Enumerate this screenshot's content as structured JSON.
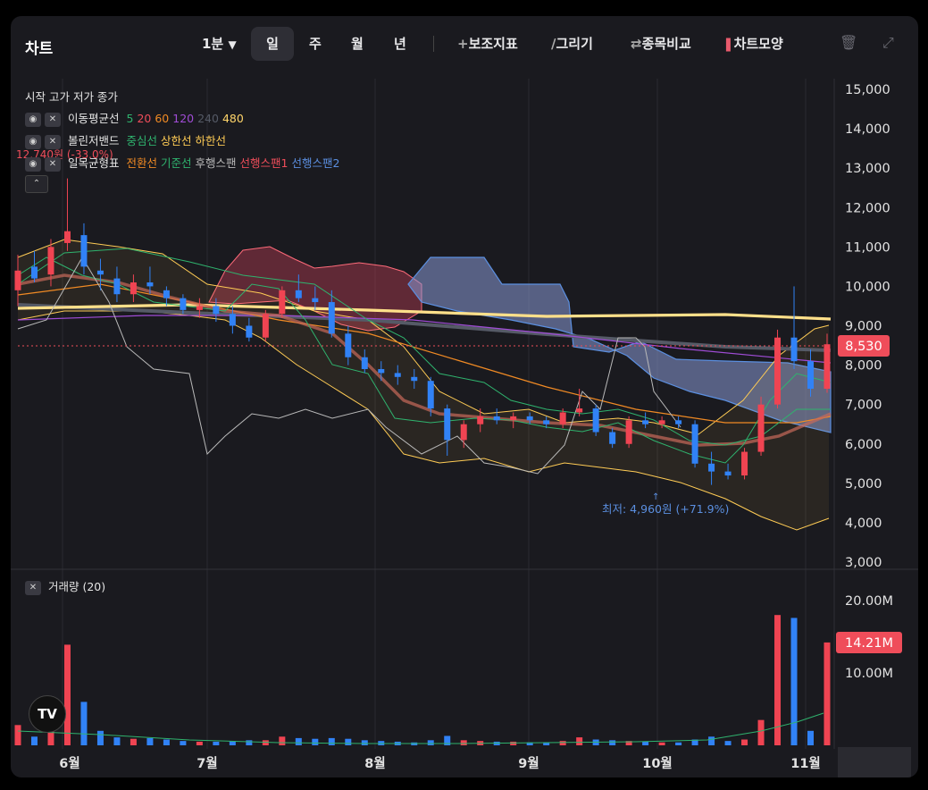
{
  "header": {
    "title": "차트",
    "interval": "1분",
    "periods": [
      "일",
      "주",
      "월",
      "년"
    ],
    "selected_period": "일",
    "tools": [
      "보조지표",
      "그리기",
      "종목비교",
      "차트모양"
    ]
  },
  "legend": {
    "ohlc_label": "시작 고가 저가 종가",
    "ma": {
      "name": "이동평균선",
      "periods": [
        {
          "label": "5",
          "color": "#2fb36e"
        },
        {
          "label": "20",
          "color": "#ef4d5a"
        },
        {
          "label": "60",
          "color": "#f08a24"
        },
        {
          "label": "120",
          "color": "#a04cd6"
        },
        {
          "label": "240",
          "color": "#555a66"
        },
        {
          "label": "480",
          "color": "#ffd56a"
        }
      ]
    },
    "bb": {
      "name": "볼린저밴드",
      "lines": [
        {
          "label": "중심선",
          "color": "#2fb36e"
        },
        {
          "label": "상한선",
          "color": "#ffcc55"
        },
        {
          "label": "하한선",
          "color": "#ffcc55"
        }
      ]
    },
    "ichimoku": {
      "name": "일목균형표",
      "lines": [
        {
          "label": "전환선",
          "color": "#f08a24"
        },
        {
          "label": "기준선",
          "color": "#2fb36e"
        },
        {
          "label": "후행스팬",
          "color": "#b9b9b9"
        },
        {
          "label": "선행스팬1",
          "color": "#ef4d5a"
        },
        {
          "label": "선행스팬2",
          "color": "#5b8fe0"
        }
      ]
    },
    "high_marker": "12,740원 (-33.0%)",
    "volume_label": "거래량 (20)"
  },
  "annotations": {
    "low_marker": "최저: 4,960원 (+71.9%)"
  },
  "price_tag": "8,530",
  "volume_tag": "14.21M",
  "chart_data": {
    "type": "candlestick",
    "y_axis": {
      "ticks": [
        "15,000",
        "14,000",
        "13,000",
        "12,000",
        "11,000",
        "10,000",
        "9,000",
        "8,000",
        "7,000",
        "6,000",
        "5,000",
        "4,000",
        "3,000"
      ],
      "range": [
        3000,
        15000
      ]
    },
    "volume_axis": {
      "ticks": [
        "20.00M",
        "10.00M"
      ],
      "range": [
        0,
        20000000
      ]
    },
    "x_axis": {
      "labels": [
        "6월",
        "7월",
        "8월",
        "9월",
        "10월",
        "11월"
      ]
    },
    "last_close": 8530,
    "last_volume_m": 14.21,
    "high": 12740,
    "low": 4960,
    "candles": [
      {
        "o": 9900,
        "h": 10800,
        "l": 9500,
        "c": 10400,
        "v": 2.8
      },
      {
        "o": 10500,
        "h": 10900,
        "l": 10100,
        "c": 10200,
        "v": 1.2
      },
      {
        "o": 10300,
        "h": 11200,
        "l": 10000,
        "c": 11000,
        "v": 3.0
      },
      {
        "o": 11100,
        "h": 12740,
        "l": 10900,
        "c": 11400,
        "v": 13.9
      },
      {
        "o": 11300,
        "h": 11600,
        "l": 10300,
        "c": 10500,
        "v": 6.0
      },
      {
        "o": 10400,
        "h": 10700,
        "l": 9900,
        "c": 10300,
        "v": 2.0
      },
      {
        "o": 10200,
        "h": 10500,
        "l": 9600,
        "c": 9800,
        "v": 1.1
      },
      {
        "o": 9800,
        "h": 10300,
        "l": 9600,
        "c": 10100,
        "v": 0.9
      },
      {
        "o": 10100,
        "h": 10500,
        "l": 9800,
        "c": 10000,
        "v": 1.0
      },
      {
        "o": 9900,
        "h": 10000,
        "l": 9500,
        "c": 9700,
        "v": 0.8
      },
      {
        "o": 9700,
        "h": 9800,
        "l": 9300,
        "c": 9400,
        "v": 0.6
      },
      {
        "o": 9400,
        "h": 9700,
        "l": 9200,
        "c": 9500,
        "v": 0.5
      },
      {
        "o": 9500,
        "h": 9700,
        "l": 9100,
        "c": 9300,
        "v": 0.5
      },
      {
        "o": 9300,
        "h": 9500,
        "l": 8800,
        "c": 9000,
        "v": 0.6
      },
      {
        "o": 9000,
        "h": 9200,
        "l": 8600,
        "c": 8700,
        "v": 0.7
      },
      {
        "o": 8700,
        "h": 9400,
        "l": 8600,
        "c": 9300,
        "v": 0.7
      },
      {
        "o": 9300,
        "h": 10000,
        "l": 9200,
        "c": 9900,
        "v": 1.2
      },
      {
        "o": 9900,
        "h": 10300,
        "l": 9600,
        "c": 9700,
        "v": 1.0
      },
      {
        "o": 9700,
        "h": 10000,
        "l": 9400,
        "c": 9600,
        "v": 0.9
      },
      {
        "o": 9600,
        "h": 9900,
        "l": 8700,
        "c": 8800,
        "v": 1.0
      },
      {
        "o": 8800,
        "h": 9000,
        "l": 8000,
        "c": 8200,
        "v": 0.9
      },
      {
        "o": 8200,
        "h": 8400,
        "l": 7800,
        "c": 7900,
        "v": 0.7
      },
      {
        "o": 7900,
        "h": 8100,
        "l": 7600,
        "c": 7800,
        "v": 0.6
      },
      {
        "o": 7800,
        "h": 8000,
        "l": 7500,
        "c": 7700,
        "v": 0.5
      },
      {
        "o": 7700,
        "h": 7900,
        "l": 7400,
        "c": 7600,
        "v": 0.4
      },
      {
        "o": 7600,
        "h": 7700,
        "l": 6700,
        "c": 6900,
        "v": 0.7
      },
      {
        "o": 6900,
        "h": 7000,
        "l": 5700,
        "c": 6100,
        "v": 1.3
      },
      {
        "o": 6100,
        "h": 6600,
        "l": 5900,
        "c": 6500,
        "v": 0.7
      },
      {
        "o": 6500,
        "h": 6900,
        "l": 6300,
        "c": 6700,
        "v": 0.6
      },
      {
        "o": 6700,
        "h": 6900,
        "l": 6500,
        "c": 6600,
        "v": 0.5
      },
      {
        "o": 6600,
        "h": 6800,
        "l": 6400,
        "c": 6700,
        "v": 0.5
      },
      {
        "o": 6700,
        "h": 6800,
        "l": 6500,
        "c": 6600,
        "v": 0.4
      },
      {
        "o": 6600,
        "h": 6700,
        "l": 6400,
        "c": 6500,
        "v": 0.4
      },
      {
        "o": 6500,
        "h": 6900,
        "l": 6400,
        "c": 6800,
        "v": 0.6
      },
      {
        "o": 6800,
        "h": 7400,
        "l": 6700,
        "c": 6900,
        "v": 1.1
      },
      {
        "o": 6900,
        "h": 7000,
        "l": 6200,
        "c": 6300,
        "v": 0.8
      },
      {
        "o": 6300,
        "h": 6400,
        "l": 5900,
        "c": 6000,
        "v": 0.7
      },
      {
        "o": 6000,
        "h": 6700,
        "l": 5900,
        "c": 6600,
        "v": 0.6
      },
      {
        "o": 6600,
        "h": 6800,
        "l": 6400,
        "c": 6500,
        "v": 0.5
      },
      {
        "o": 6500,
        "h": 6700,
        "l": 6400,
        "c": 6600,
        "v": 0.4
      },
      {
        "o": 6600,
        "h": 6700,
        "l": 6400,
        "c": 6500,
        "v": 0.4
      },
      {
        "o": 6500,
        "h": 6600,
        "l": 5400,
        "c": 5500,
        "v": 0.8
      },
      {
        "o": 5500,
        "h": 5800,
        "l": 4960,
        "c": 5300,
        "v": 1.2
      },
      {
        "o": 5300,
        "h": 5500,
        "l": 5100,
        "c": 5200,
        "v": 0.6
      },
      {
        "o": 5200,
        "h": 5900,
        "l": 5100,
        "c": 5800,
        "v": 0.8
      },
      {
        "o": 5800,
        "h": 7200,
        "l": 5700,
        "c": 7000,
        "v": 3.5
      },
      {
        "o": 7000,
        "h": 8900,
        "l": 6900,
        "c": 8700,
        "v": 18.0
      },
      {
        "o": 8700,
        "h": 10000,
        "l": 7900,
        "c": 8100,
        "v": 17.6
      },
      {
        "o": 8100,
        "h": 8400,
        "l": 7200,
        "c": 7400,
        "v": 2.0
      },
      {
        "o": 7400,
        "h": 8800,
        "l": 7300,
        "c": 8530,
        "v": 14.21
      }
    ]
  }
}
